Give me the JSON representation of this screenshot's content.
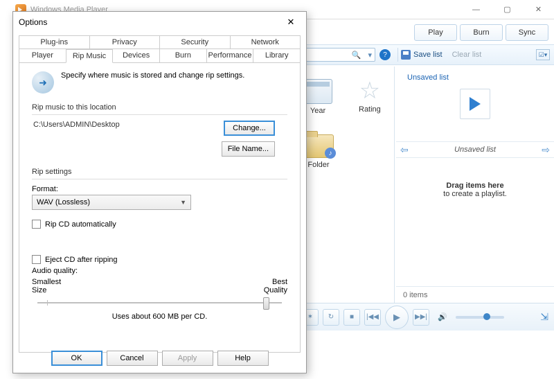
{
  "window": {
    "title": "Windows Media Player",
    "controls": {
      "min": "—",
      "max": "▢",
      "close": "✕"
    }
  },
  "tabs": {
    "play": "Play",
    "burn": "Burn",
    "sync": "Sync"
  },
  "toolbar": {
    "save": "Save list",
    "clear": "Clear list"
  },
  "lib": {
    "year": "Year",
    "rating": "Rating",
    "folder": "Folder"
  },
  "playlist": {
    "label": "Unsaved list",
    "nav_title": "Unsaved list",
    "drag_title": "Drag items here",
    "drag_sub": "to create a playlist.",
    "footer": "0 items"
  },
  "dialog": {
    "title": "Options",
    "tabs_row1": [
      "Plug-ins",
      "Privacy",
      "Security",
      "Network"
    ],
    "tabs_row2": [
      "Player",
      "Rip Music",
      "Devices",
      "Burn",
      "Performance",
      "Library"
    ],
    "description": "Specify where music is stored and change rip settings.",
    "group_location": "Rip music to this location",
    "path": "C:\\Users\\ADMIN\\Desktop",
    "btn_change": "Change...",
    "btn_filename": "File Name...",
    "group_settings": "Rip settings",
    "format_label": "Format:",
    "format_value": "WAV (Lossless)",
    "chk_auto": "Rip CD automatically",
    "chk_eject": "Eject CD after ripping",
    "quality_label": "Audio quality:",
    "quality_min": "Smallest\nSize",
    "quality_max": "Best\nQuality",
    "usage": "Uses about 600 MB per CD.",
    "ok": "OK",
    "cancel": "Cancel",
    "apply": "Apply",
    "help": "Help"
  }
}
